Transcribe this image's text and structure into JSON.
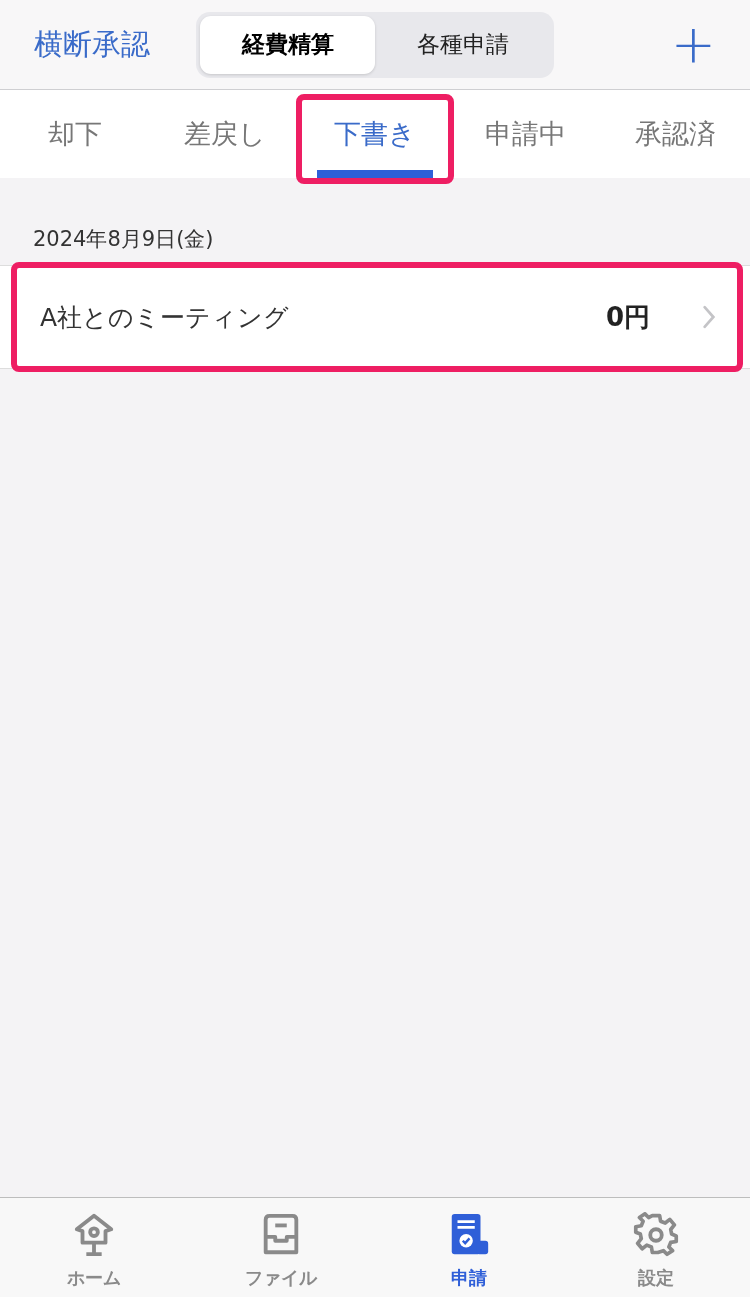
{
  "header": {
    "title": "横断承認",
    "segments": [
      {
        "label": "経費精算",
        "selected": true
      },
      {
        "label": "各種申請",
        "selected": false
      }
    ],
    "add_button": "+"
  },
  "tabs": [
    {
      "label": "却下",
      "selected": false
    },
    {
      "label": "差戻し",
      "selected": false
    },
    {
      "label": "下書き",
      "selected": true,
      "highlighted": true
    },
    {
      "label": "申請中",
      "selected": false
    },
    {
      "label": "承認済",
      "selected": false
    }
  ],
  "sections": [
    {
      "date": "2024年8月9日(金)",
      "items": [
        {
          "title": "A社とのミーティング",
          "amount": "0円",
          "highlighted": true
        }
      ]
    }
  ],
  "bottom_nav": [
    {
      "label": "ホーム",
      "kind": "home",
      "selected": false
    },
    {
      "label": "ファイル",
      "kind": "file",
      "selected": false
    },
    {
      "label": "申請",
      "kind": "request",
      "selected": true
    },
    {
      "label": "設定",
      "kind": "settings",
      "selected": false
    }
  ]
}
